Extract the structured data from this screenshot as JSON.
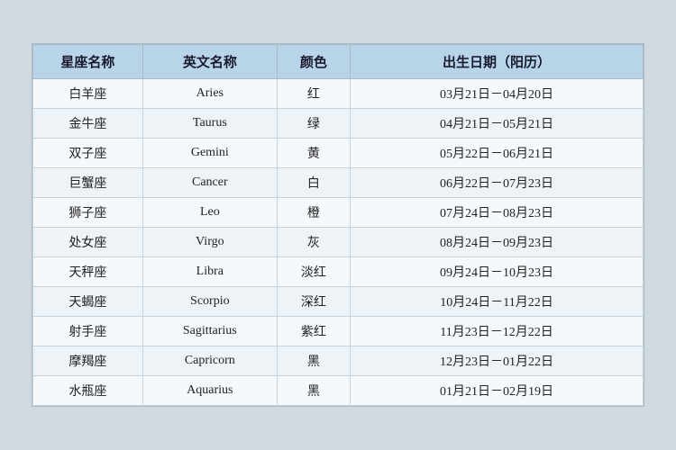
{
  "table": {
    "headers": {
      "zh_name": "星座名称",
      "en_name": "英文名称",
      "color": "颜色",
      "birthday": "出生日期（阳历）"
    },
    "rows": [
      {
        "zh": "白羊座",
        "en": "Aries",
        "color": "红",
        "date": "03月21日－04月20日"
      },
      {
        "zh": "金牛座",
        "en": "Taurus",
        "color": "绿",
        "date": "04月21日－05月21日"
      },
      {
        "zh": "双子座",
        "en": "Gemini",
        "color": "黄",
        "date": "05月22日－06月21日"
      },
      {
        "zh": "巨蟹座",
        "en": "Cancer",
        "color": "白",
        "date": "06月22日－07月23日"
      },
      {
        "zh": "狮子座",
        "en": "Leo",
        "color": "橙",
        "date": "07月24日－08月23日"
      },
      {
        "zh": "处女座",
        "en": "Virgo",
        "color": "灰",
        "date": "08月24日－09月23日"
      },
      {
        "zh": "天秤座",
        "en": "Libra",
        "color": "淡红",
        "date": "09月24日－10月23日"
      },
      {
        "zh": "天蝎座",
        "en": "Scorpio",
        "color": "深红",
        "date": "10月24日－11月22日"
      },
      {
        "zh": "射手座",
        "en": "Sagittarius",
        "color": "紫红",
        "date": "11月23日－12月22日"
      },
      {
        "zh": "摩羯座",
        "en": "Capricorn",
        "color": "黑",
        "date": "12月23日－01月22日"
      },
      {
        "zh": "水瓶座",
        "en": "Aquarius",
        "color": "黑",
        "date": "01月21日－02月19日"
      }
    ]
  }
}
